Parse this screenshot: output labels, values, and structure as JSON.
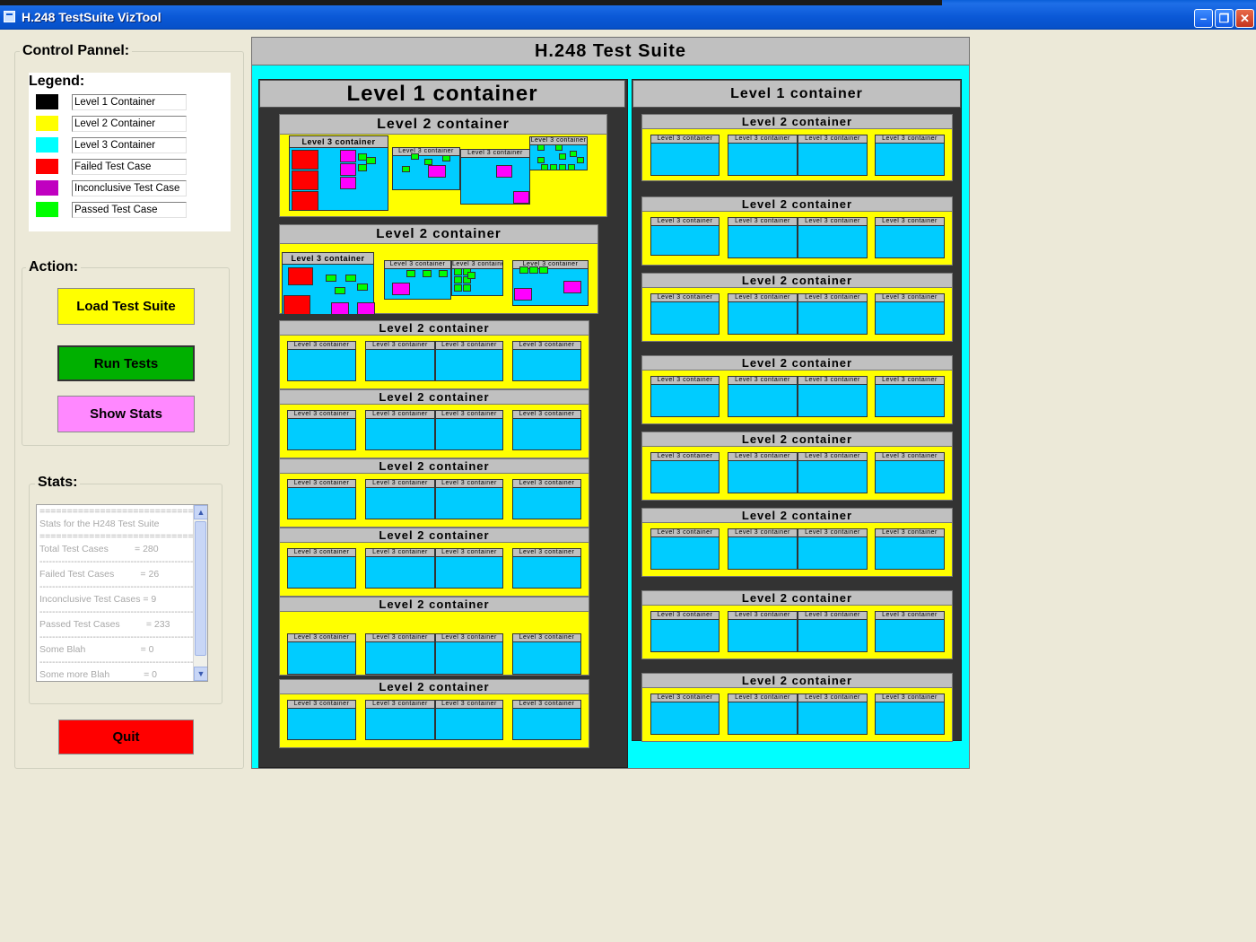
{
  "window": {
    "title": "H.248 TestSuite VizTool"
  },
  "control_panel": {
    "title": "Control Pannel:",
    "legend": {
      "title": "Legend:",
      "items": [
        {
          "label": "Level 1 Container",
          "color": "#000000"
        },
        {
          "label": "Level 2 Container",
          "color": "#ffff00"
        },
        {
          "label": "Level 3 Container",
          "color": "#00ffff"
        },
        {
          "label": "Failed Test Case",
          "color": "#ff0000"
        },
        {
          "label": "Inconclusive Test Case",
          "color": "#c000c0"
        },
        {
          "label": "Passed Test Case",
          "color": "#00ff00"
        }
      ]
    },
    "action": {
      "title": "Action:",
      "load_label": "Load Test Suite",
      "run_label": "Run Tests",
      "stats_label": "Show Stats",
      "load_color": "#ffff00",
      "run_color": "#00b000",
      "stats_color": "#ff88ff"
    },
    "stats": {
      "title": "Stats:",
      "lines": [
        "==========================================",
        "Stats for the H248 Test Suite",
        "==========================================",
        "Total Test Cases          = 280",
        "------------------------------------------------------------------",
        "Failed Test Cases          = 26",
        "------------------------------------------------------------------",
        "Inconclusive Test Cases = 9",
        "------------------------------------------------------------------",
        "Passed Test Cases          = 233",
        "------------------------------------------------------------------",
        "Some Blah                     = 0",
        "------------------------------------------------------------------",
        "Some more Blah             = 0"
      ]
    },
    "quit_label": "Quit",
    "quit_color": "#ff0000"
  },
  "viz": {
    "suite_title": "H.248 Test Suite",
    "level1_label": "Level 1 container",
    "level2_label": "Level 2 container",
    "level3_label": "Level 3 container"
  }
}
